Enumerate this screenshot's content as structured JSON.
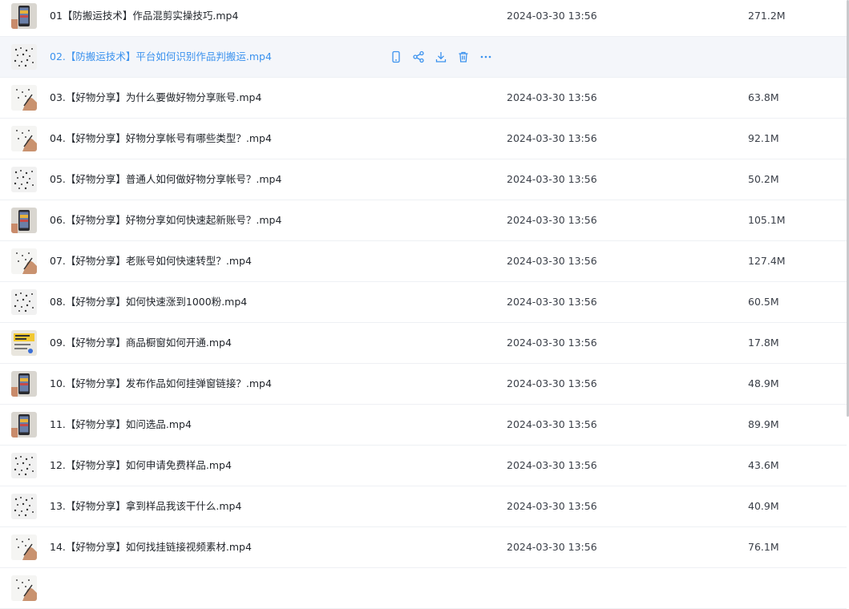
{
  "files": [
    {
      "name": "01【防搬运技术】作品混剪实操技巧.mp4",
      "date": "2024-03-30 13:56",
      "size": "271.2M",
      "thumb": "phone"
    },
    {
      "name": "02.【防搬运技术】平台如何识别作品判搬运.mp4",
      "date": "",
      "size": "",
      "thumb": "dots",
      "hover": true
    },
    {
      "name": "03.【好物分享】为什么要做好物分享账号.mp4",
      "date": "2024-03-30 13:56",
      "size": "63.8M",
      "thumb": "hand"
    },
    {
      "name": "04.【好物分享】好物分享帐号有哪些类型？.mp4",
      "date": "2024-03-30 13:56",
      "size": "92.1M",
      "thumb": "hand"
    },
    {
      "name": "05.【好物分享】普通人如何做好物分享帐号？.mp4",
      "date": "2024-03-30 13:56",
      "size": "50.2M",
      "thumb": "dots"
    },
    {
      "name": "06.【好物分享】好物分享如何快速起新账号？.mp4",
      "date": "2024-03-30 13:56",
      "size": "105.1M",
      "thumb": "phone"
    },
    {
      "name": "07.【好物分享】老账号如何快速转型？.mp4",
      "date": "2024-03-30 13:56",
      "size": "127.4M",
      "thumb": "hand"
    },
    {
      "name": "08.【好物分享】如何快速涨到1000粉.mp4",
      "date": "2024-03-30 13:56",
      "size": "60.5M",
      "thumb": "dots"
    },
    {
      "name": "09.【好物分享】商品橱窗如何开通.mp4",
      "date": "2024-03-30 13:56",
      "size": "17.8M",
      "thumb": "yellow"
    },
    {
      "name": "10.【好物分享】发布作品如何挂弹窗链接？.mp4",
      "date": "2024-03-30 13:56",
      "size": "48.9M",
      "thumb": "phone"
    },
    {
      "name": "11.【好物分享】如问选品.mp4",
      "date": "2024-03-30 13:56",
      "size": "89.9M",
      "thumb": "phone"
    },
    {
      "name": "12.【好物分享】如何申请免费样品.mp4",
      "date": "2024-03-30 13:56",
      "size": "43.6M",
      "thumb": "dots"
    },
    {
      "name": "13.【好物分享】拿到样品我该干什么.mp4",
      "date": "2024-03-30 13:56",
      "size": "40.9M",
      "thumb": "dots"
    },
    {
      "name": "14.【好物分享】如何找挂链接视频素材.mp4",
      "date": "2024-03-30 13:56",
      "size": "76.1M",
      "thumb": "hand"
    },
    {
      "name": "",
      "date": "",
      "size": "",
      "thumb": "hand"
    }
  ],
  "hover_actions": [
    {
      "icon": "phone-icon"
    },
    {
      "icon": "share-icon"
    },
    {
      "icon": "download-icon"
    },
    {
      "icon": "trash-icon"
    },
    {
      "icon": "more-icon"
    }
  ],
  "colors": {
    "accent": "#3b92ee",
    "hover_bg": "#f4f6fa",
    "text": "#1f2329",
    "icon": "#3b92ee"
  }
}
